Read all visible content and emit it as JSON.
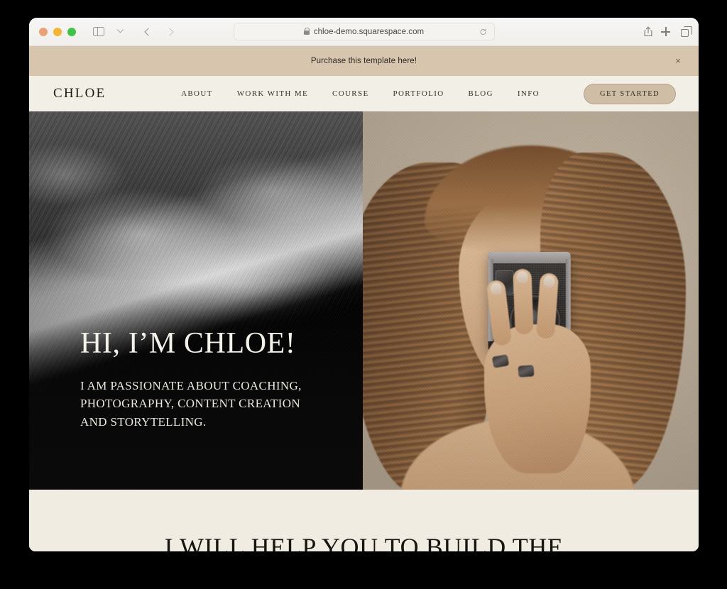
{
  "browser": {
    "traffic_lights": [
      "close",
      "minimize",
      "zoom"
    ],
    "sidebar_toggle": "sidebar-icon",
    "tab_overview_chevron": "chevron-down-icon",
    "back_label": "back-icon",
    "forward_label": "forward-icon",
    "url": "chloe-demo.squarespace.com",
    "lock": "lock-icon",
    "reload": "reload-icon",
    "share": "share-icon",
    "new_tab": "plus-icon",
    "tabs_overview": "tabs-icon"
  },
  "announcement": {
    "text": "Purchase this template here!",
    "close_label": "×",
    "background": "#d7c5ae"
  },
  "header": {
    "logo": "CHLOE",
    "nav": [
      {
        "label": "ABOUT"
      },
      {
        "label": "WORK WITH ME"
      },
      {
        "label": "COURSE"
      },
      {
        "label": "PORTFOLIO"
      },
      {
        "label": "BLOG"
      },
      {
        "label": "INFO"
      }
    ],
    "cta_label": "GET STARTED",
    "cta_color": "#cfbda6",
    "background": "#f2efe6"
  },
  "hero": {
    "title": "HI, I’M CHLOE!",
    "subtitle": "I AM PASSIONATE ABOUT COACHING, PHOTOGRAPHY, CONTENT CREATION AND STORYTELLING.",
    "left_image_alt": "blurred black and white motion-streaked seascape",
    "right_image_alt": "woman with long hair holding a vintage film camera to her face"
  },
  "section_below": {
    "heading": "I WILL HELP YOU TO BUILD THE",
    "background": "#f0ece2"
  }
}
